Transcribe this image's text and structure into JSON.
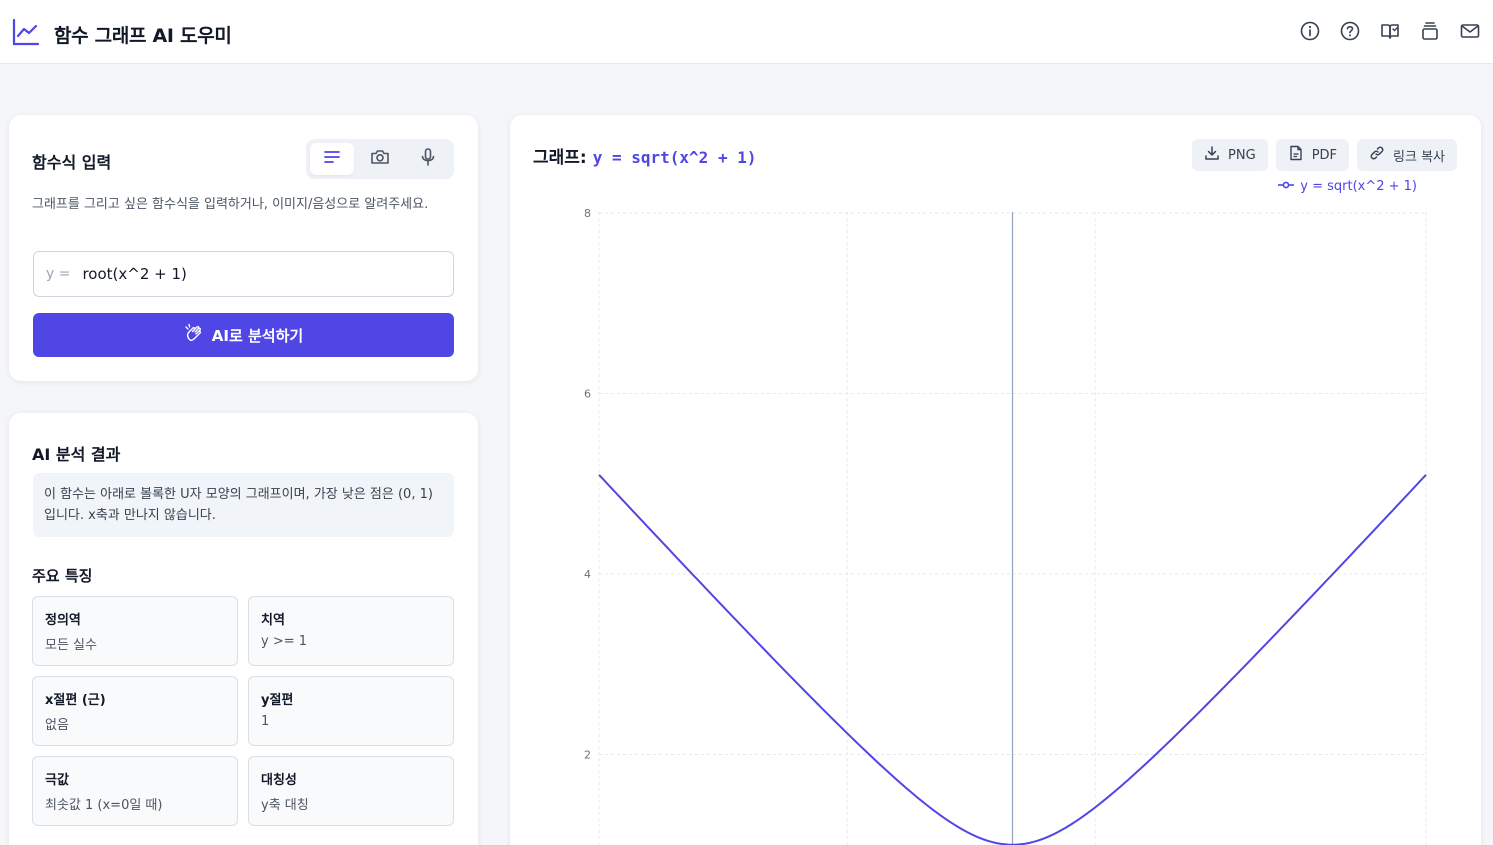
{
  "app": {
    "title": "함수 그래프 AI 도우미"
  },
  "topbar": {
    "icons": [
      "info-icon",
      "help-icon",
      "book-icon",
      "layers-icon",
      "mail-icon"
    ]
  },
  "input_card": {
    "title": "함수식 입력",
    "modes": [
      "text-mode",
      "camera-mode",
      "voice-mode"
    ],
    "description": "그래프를 그리고 싶은 함수식을 입력하거나, 이미지/음성으로 알려주세요.",
    "prefix": "y =",
    "value": "root(x^2 + 1)",
    "analyze_label": "AI로 분석하기"
  },
  "analysis_card": {
    "title": "AI 분석 결과",
    "summary": "이 함수는 아래로 볼록한 U자 모양의 그래프이며, 가장 낮은 점은 (0, 1)입니다. x축과 만나지 않습니다.",
    "features_title": "주요 특징",
    "features": [
      {
        "name": "정의역",
        "value": "모든 실수"
      },
      {
        "name": "치역",
        "value": "y >= 1"
      },
      {
        "name": "x절편 (근)",
        "value": "없음"
      },
      {
        "name": "y절편",
        "value": "1"
      },
      {
        "name": "극값",
        "value": "최솟값 1 (x=0일 때)"
      },
      {
        "name": "대칭성",
        "value": "y축 대칭"
      }
    ]
  },
  "graph_card": {
    "title_label": "그래프:",
    "equation": "y = sqrt(x^2 + 1)",
    "buttons": {
      "png": "PNG",
      "pdf": "PDF",
      "copy_link": "링크 복사"
    },
    "legend": "y = sqrt(x^2 + 1)"
  },
  "colors": {
    "accent": "#4f46e5"
  },
  "chart_data": {
    "type": "line",
    "series": [
      {
        "name": "y = sqrt(x^2 + 1)",
        "function": "sqrt(x^2 + 1)",
        "x_range": [
          -5,
          5
        ],
        "color": "#4f46e5"
      }
    ],
    "y_ticks": [
      "2",
      "4",
      "6",
      "8"
    ],
    "xlim": [
      -5,
      5
    ],
    "ylim": [
      1,
      8
    ],
    "grid": true,
    "legend_position": "top-right"
  }
}
